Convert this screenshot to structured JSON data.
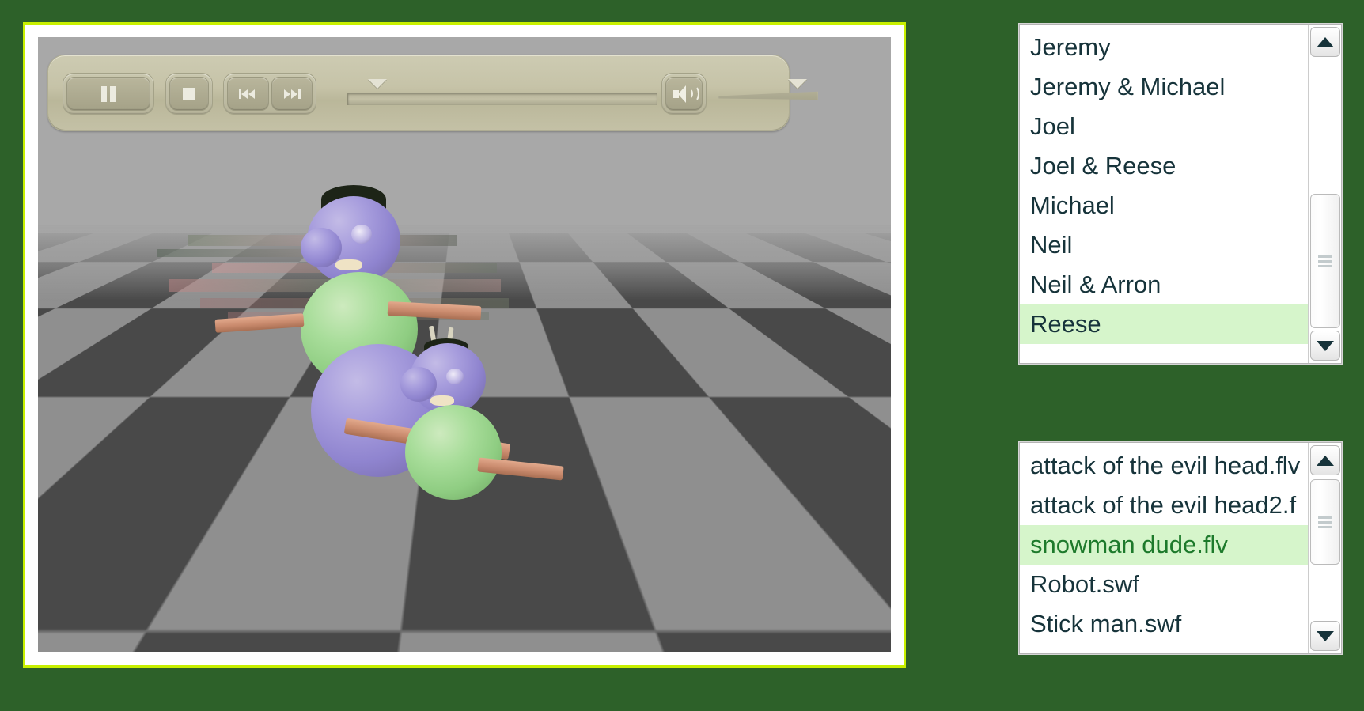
{
  "theme": {
    "page_background": "#2d6129",
    "player_border": "#c8f000",
    "player_padding": "#ffffff",
    "control_bar": "#c6c3a8",
    "selection_background": "#d6f5cb",
    "selection_text": "#1d7a2b",
    "list_text": "#16333a"
  },
  "player": {
    "controls": {
      "pause_label": "Pause",
      "stop_label": "Stop",
      "rewind_label": "Rewind",
      "forward_label": "Fast Forward",
      "mute_label": "Mute",
      "seek_label": "Seek",
      "volume_label": "Volume"
    },
    "icons": {
      "pause": "pause-icon",
      "stop": "stop-icon",
      "rewind": "rewind-icon",
      "forward": "fast-forward-icon",
      "speaker": "speaker-icon",
      "seek_handle": "seek-handle-icon",
      "volume_handle": "volume-handle-icon"
    },
    "video": {
      "scene_description": "3D rendered snowman characters on a checkerboard floor"
    }
  },
  "people_list": {
    "name": "people-list",
    "items": [
      {
        "label": "Jeremy",
        "selected": false
      },
      {
        "label": "Jeremy & Michael",
        "selected": false
      },
      {
        "label": "Joel",
        "selected": false
      },
      {
        "label": "Joel & Reese",
        "selected": false
      },
      {
        "label": "Michael",
        "selected": false
      },
      {
        "label": "Neil",
        "selected": false
      },
      {
        "label": "Neil & Arron",
        "selected": false
      },
      {
        "label": "Reese",
        "selected": true
      }
    ],
    "scrollbar": {
      "up_icon": "scroll-up-arrow-icon",
      "down_icon": "scroll-down-arrow-icon",
      "thumb_top_percent": 55,
      "thumb_height_percent": 42
    }
  },
  "files_list": {
    "name": "files-list",
    "items": [
      {
        "label": "attack of the evil head.flv",
        "selected": false
      },
      {
        "label": "attack of the evil head2.f",
        "selected": false
      },
      {
        "label": "snowman dude.flv",
        "selected": true
      },
      {
        "label": "Robot.swf",
        "selected": false
      },
      {
        "label": "Stick man.swf",
        "selected": false
      }
    ],
    "scrollbar": {
      "up_icon": "scroll-up-arrow-icon",
      "down_icon": "scroll-down-arrow-icon",
      "thumb_top_percent": 16,
      "thumb_height_percent": 40
    }
  }
}
